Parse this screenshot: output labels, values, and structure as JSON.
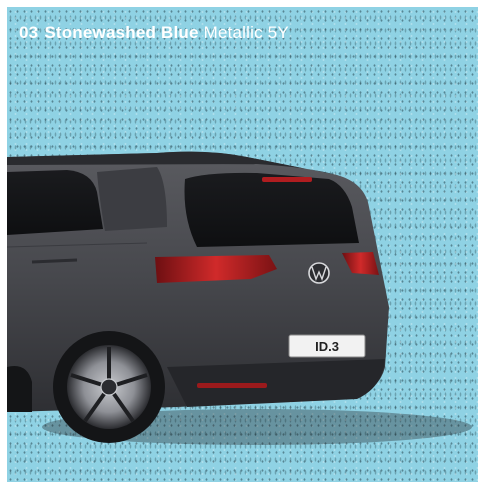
{
  "caption": {
    "number": "03",
    "color_name": "Stonewashed Blue",
    "finish": "Metallic 5Y"
  },
  "car": {
    "plate": "ID.3",
    "body_color": "#4a4b4f",
    "background_color": "#8fd2e4"
  }
}
